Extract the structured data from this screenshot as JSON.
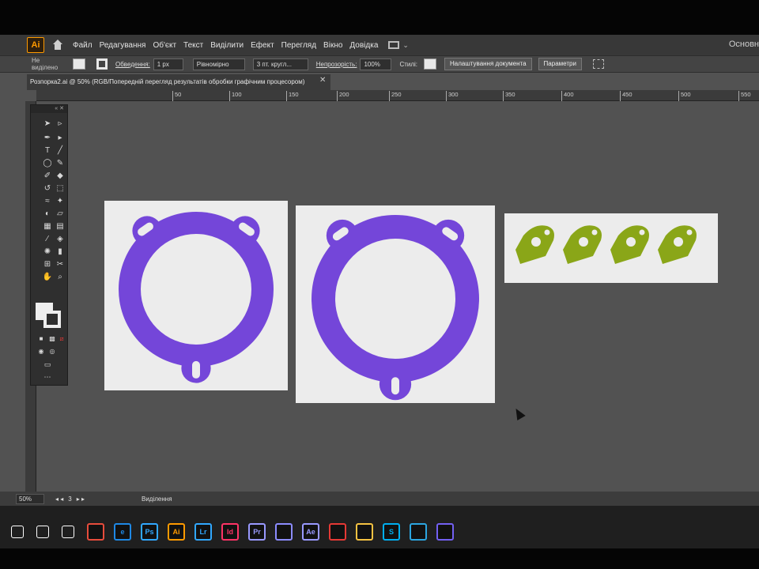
{
  "menubar": {
    "logo": "Ai",
    "items": [
      "Файл",
      "Редагування",
      "Об'єкт",
      "Текст",
      "Виділити",
      "Ефект",
      "Перегляд",
      "Вікно",
      "Довідка"
    ],
    "workspace": "Основн"
  },
  "controlbar": {
    "selection": "Не виділено",
    "stroke_label": "Обведення:",
    "stroke_value": "1 px",
    "profile": "Рівномірно",
    "brush": "3 пт. кругл...",
    "opacity_label": "Непрозорість:",
    "opacity_value": "100%",
    "styles_label": "Стилі:",
    "doc_setup_button": "Налаштування документа",
    "preferences_button": "Параметри"
  },
  "document": {
    "tab_title": "Розпорка2.ai @ 50% (RGB/Попередній перегляд результатів обробки графічним процесором)",
    "close_glyph": "✕"
  },
  "ruler": {
    "ticks": [
      "50",
      "100",
      "150",
      "200",
      "250",
      "300",
      "350",
      "400",
      "450",
      "500",
      "550"
    ]
  },
  "colors": {
    "ring": "#7446d9",
    "tab_shape": "#8aa618",
    "artboard": "#ececec",
    "canvas": "#525252"
  },
  "statusbar": {
    "zoom": "50%",
    "artboard_number": "3",
    "mode": "Виділення"
  },
  "taskbar": {
    "apps": [
      {
        "name": "windows-start-icon",
        "label": "",
        "color": "#ffffff"
      },
      {
        "name": "search-icon",
        "label": "",
        "color": "#ffffff"
      },
      {
        "name": "task-view-icon",
        "label": "",
        "color": "#ffffff"
      },
      {
        "name": "chrome-icon",
        "label": "",
        "color": "#e74c3c"
      },
      {
        "name": "edge-icon",
        "label": "e",
        "color": "#1e88e5"
      },
      {
        "name": "photoshop-icon",
        "label": "Ps",
        "color": "#31a8ff"
      },
      {
        "name": "illustrator-icon",
        "label": "Ai",
        "color": "#ff9a00"
      },
      {
        "name": "lightroom-icon",
        "label": "Lr",
        "color": "#31a8ff"
      },
      {
        "name": "indesign-icon",
        "label": "Id",
        "color": "#ff3366"
      },
      {
        "name": "premiere-icon",
        "label": "Pr",
        "color": "#9999ff"
      },
      {
        "name": "media-encoder-icon",
        "label": "",
        "color": "#8c8cff"
      },
      {
        "name": "after-effects-icon",
        "label": "Ae",
        "color": "#9999ff"
      },
      {
        "name": "acrobat-icon",
        "label": "",
        "color": "#e53935"
      },
      {
        "name": "file-explorer-icon",
        "label": "",
        "color": "#f5c242"
      },
      {
        "name": "skype-icon",
        "label": "S",
        "color": "#00aff0"
      },
      {
        "name": "telegram-icon",
        "label": "",
        "color": "#2ca5e0"
      },
      {
        "name": "viber-icon",
        "label": "",
        "color": "#7360f2"
      }
    ]
  }
}
